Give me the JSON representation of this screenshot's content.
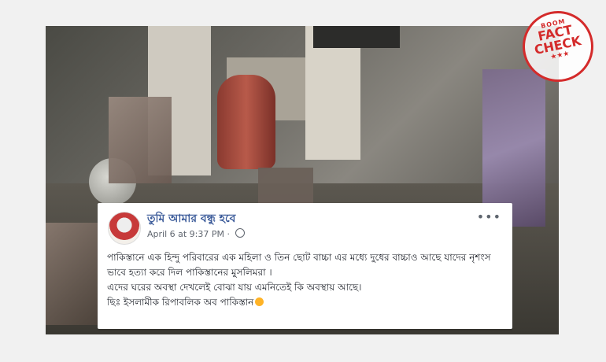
{
  "stamp": {
    "top": "BOOM",
    "line1": "FACT",
    "line2": "CHECK",
    "stars": "★★★"
  },
  "post": {
    "author": "তুমি আমার বন্ধু হবে",
    "timestamp": "April 6 at 9:37 PM",
    "separator": "·",
    "more": "•••",
    "paragraphs": [
      "পাকিস্তানে এক হিন্দু পরিবারের এক মহিলা ও তিন ছোট বাচ্চা এর মধ্যে দুধের বাচ্চাও আছে যাদের নৃশংস ভাবে হত্যা করে দিল পাকিস্তানের মুসলিমরা ।",
      "এদের ঘরের অবস্থা দেখলেই বোঝা যায় এমনিতেই কি অবস্থায় আছে।",
      "ছিঃ ইসলামীক রিপাবলিক অব পাকিস্তান"
    ]
  }
}
